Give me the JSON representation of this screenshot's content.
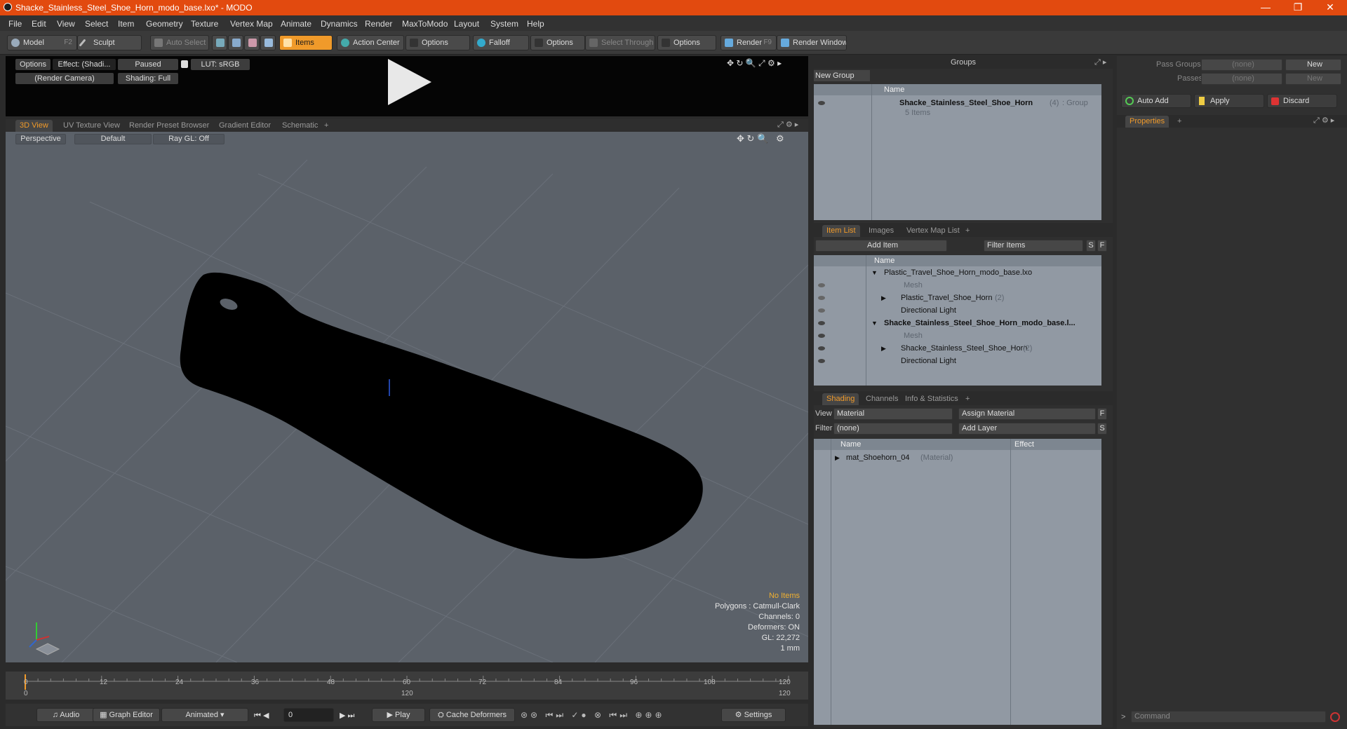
{
  "window": {
    "title": "Shacke_Stainless_Steel_Shoe_Horn_modo_base.lxo* - MODO",
    "minimize": "—",
    "restore": "❐",
    "close": "✕"
  },
  "menu": [
    "File",
    "Edit",
    "View",
    "Select",
    "Item",
    "Geometry",
    "Texture",
    "Vertex Map",
    "Animate",
    "Dynamics",
    "Render",
    "MaxToModo",
    "Layout",
    "System",
    "Help"
  ],
  "toolbar": {
    "model": "Model",
    "model_key": "F2",
    "sculpt": "Sculpt",
    "auto_select": "Auto Select",
    "items": "Items",
    "action_center": "Action Center",
    "options1": "Options",
    "falloff": "Falloff",
    "options2": "Options",
    "select_through": "Select Through",
    "options3": "Options",
    "render": "Render",
    "render_key": "F9",
    "render_window": "Render Window"
  },
  "preview": {
    "options": "Options",
    "effect": "Effect: (Shadi...",
    "paused": "Paused",
    "lut": "LUT: sRGB",
    "camera": "(Render Camera)",
    "shading": "Shading: Full"
  },
  "viewport_tabs": [
    "3D View",
    "UV Texture View",
    "Render Preset Browser",
    "Gradient Editor",
    "Schematic",
    "+"
  ],
  "viewport": {
    "perspective": "Perspective",
    "default": "Default",
    "raygl": "Ray GL: Off",
    "info": {
      "no_items": "No Items",
      "polygons": "Polygons : Catmull-Clark",
      "channels": "Channels: 0",
      "deformers": "Deformers: ON",
      "gl": "GL: 22,272",
      "unit": "1 mm"
    }
  },
  "timeline": {
    "ticks": [
      "0",
      "12",
      "24",
      "36",
      "48",
      "60",
      "72",
      "84",
      "96",
      "108",
      "120"
    ],
    "start": "0",
    "mid": "120",
    "end": "120"
  },
  "bottombar": {
    "audio": "Audio",
    "graph_editor": "Graph Editor",
    "animated": "Animated",
    "frame": "0",
    "play": "Play",
    "cache_deformers": "Cache Deformers",
    "settings": "Settings"
  },
  "groups": {
    "title": "Groups",
    "new_group": "New Group",
    "col_name": "Name",
    "item_name": "Shacke_Stainless_Steel_Shoe_Horn",
    "item_count": "(4)",
    "item_type": ": Group",
    "item_sub": "5 Items"
  },
  "item_list": {
    "tabs": [
      "Item List",
      "Images",
      "Vertex Map List",
      "+"
    ],
    "add_item": "Add Item",
    "filter": "Filter Items",
    "s": "S",
    "f": "F",
    "col_name": "Name",
    "rows": [
      {
        "label": "Plastic_Travel_Shoe_Horn_modo_base.lxo",
        "extra": ""
      },
      {
        "label": "Mesh",
        "extra": ""
      },
      {
        "label": "Plastic_Travel_Shoe_Horn",
        "extra": "(2)"
      },
      {
        "label": "Directional Light",
        "extra": ""
      },
      {
        "label": "Shacke_Stainless_Steel_Shoe_Horn_modo_base.l...",
        "extra": ""
      },
      {
        "label": "Mesh",
        "extra": ""
      },
      {
        "label": "Shacke_Stainless_Steel_Shoe_Horn",
        "extra": "(2)"
      },
      {
        "label": "Directional Light",
        "extra": ""
      }
    ]
  },
  "shading": {
    "tabs": [
      "Shading",
      "Channels",
      "Info & Statistics",
      "+"
    ],
    "view_label": "View",
    "view_value": "Material",
    "assign_material": "Assign Material",
    "f": "F",
    "filter_label": "Filter",
    "filter_value": "(none)",
    "add_layer": "Add Layer",
    "s": "S",
    "col_name": "Name",
    "col_effect": "Effect",
    "material": "mat_Shoehorn_04",
    "material_type": "(Material)"
  },
  "properties": {
    "pass_groups_label": "Pass Groups",
    "pass_groups_value": "(none)",
    "new1": "New",
    "passes_label": "Passes",
    "passes_value": "(none)",
    "new2": "New",
    "auto_add": "Auto Add",
    "apply": "Apply",
    "discard": "Discard",
    "tab": "Properties",
    "plus": "+",
    "command_placeholder": "Command"
  }
}
